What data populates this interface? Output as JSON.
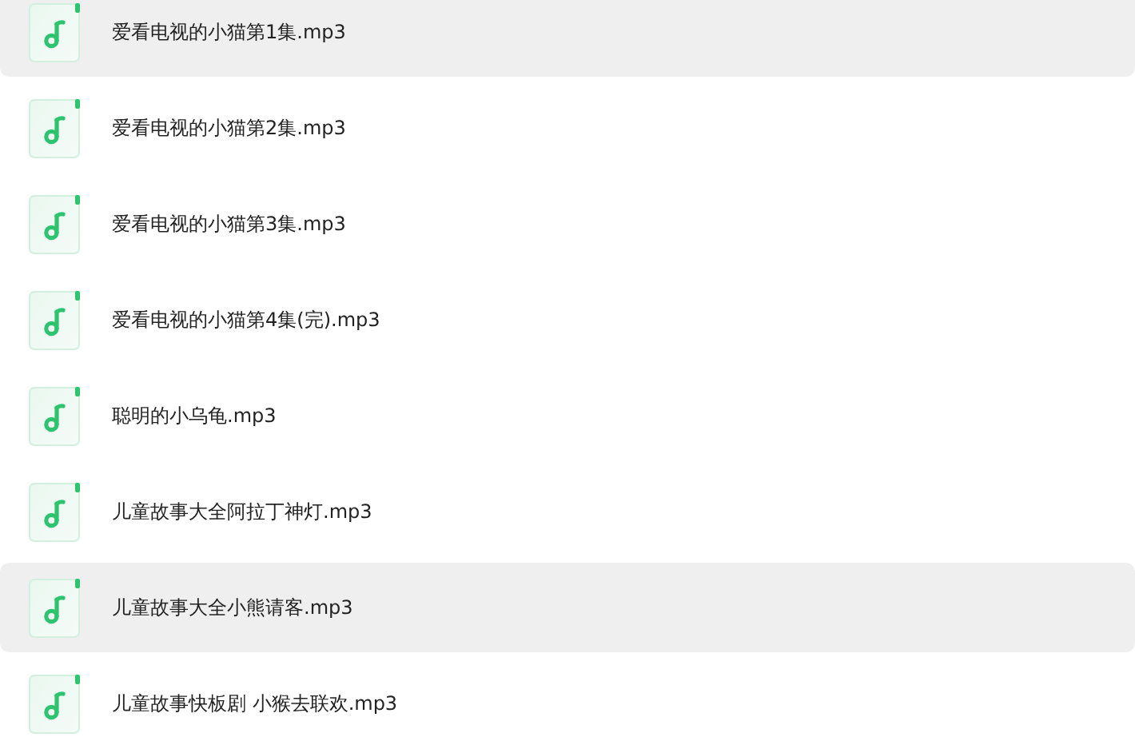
{
  "files": [
    {
      "name": "爱看电视的小猫第1集.mp3",
      "selected": true
    },
    {
      "name": "爱看电视的小猫第2集.mp3",
      "selected": false
    },
    {
      "name": "爱看电视的小猫第3集.mp3",
      "selected": false
    },
    {
      "name": "爱看电视的小猫第4集(完).mp3",
      "selected": false
    },
    {
      "name": "聪明的小乌龟.mp3",
      "selected": false
    },
    {
      "name": "儿童故事大全阿拉丁神灯.mp3",
      "selected": false
    },
    {
      "name": "儿童故事大全小熊请客.mp3",
      "selected": true
    },
    {
      "name": "儿童故事快板剧 小猴去联欢.mp3",
      "selected": false
    }
  ]
}
